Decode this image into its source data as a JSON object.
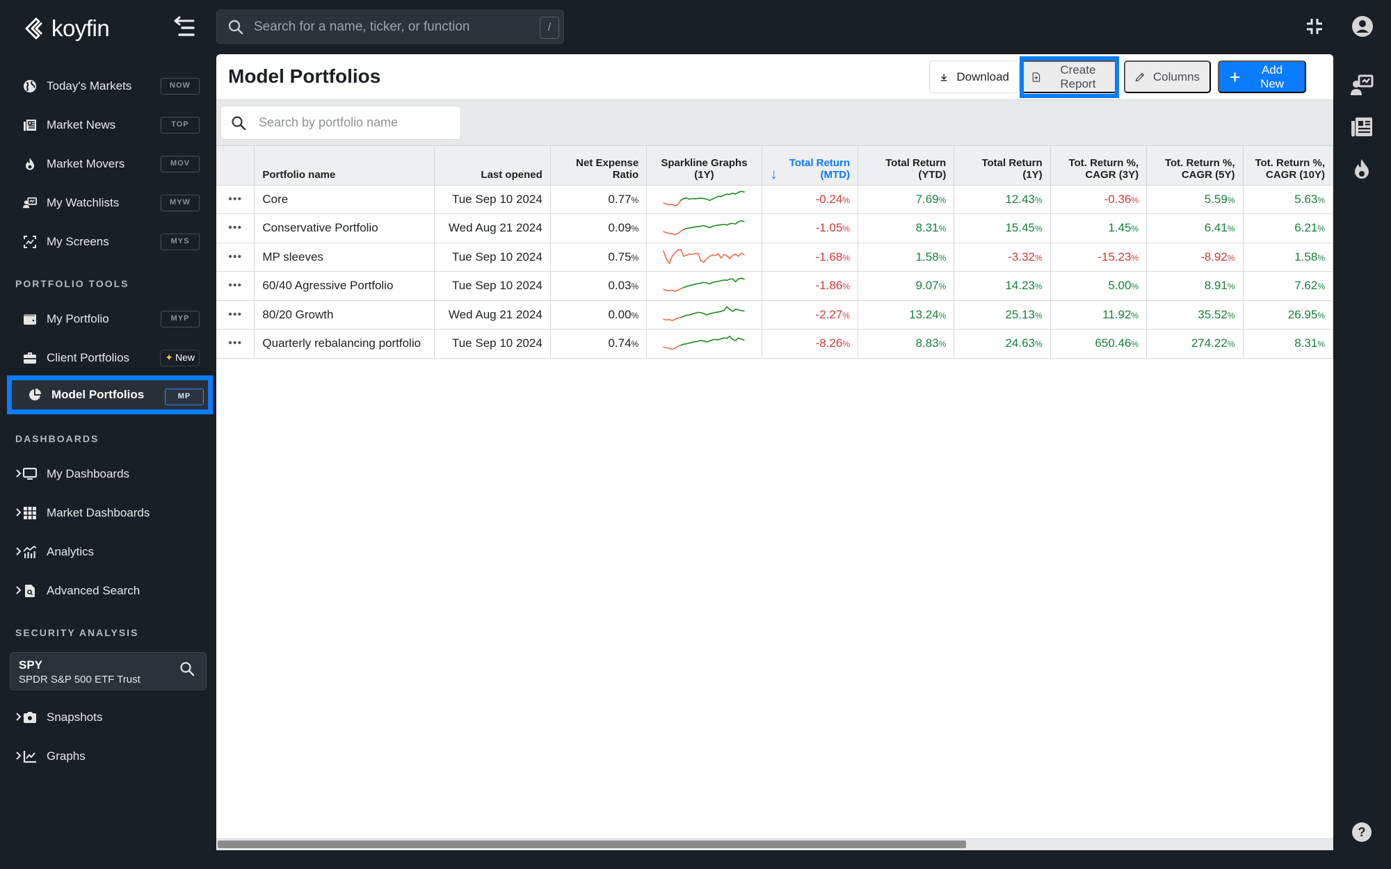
{
  "app": {
    "brand": "koyfin"
  },
  "topbar": {
    "search_placeholder": "Search for a name, ticker, or function",
    "search_shortcut": "/"
  },
  "sidebar": {
    "items_top": [
      {
        "label": "Today's Markets",
        "badge": "NOW",
        "icon": "globe-icon"
      },
      {
        "label": "Market News",
        "badge": "TOP",
        "icon": "newspaper-icon"
      },
      {
        "label": "Market Movers",
        "badge": "MOV",
        "icon": "flame-icon"
      },
      {
        "label": "My Watchlists",
        "badge": "MYW",
        "icon": "watchlist-icon"
      },
      {
        "label": "My Screens",
        "badge": "MYS",
        "icon": "screens-icon"
      }
    ],
    "portfolio_tools_title": "PORTFOLIO TOOLS",
    "portfolio_items": [
      {
        "label": "My Portfolio",
        "badge": "MYP",
        "icon": "wallet-icon"
      },
      {
        "label": "Client Portfolios",
        "badge": "New",
        "icon": "briefcase-icon"
      },
      {
        "label": "Model Portfolios",
        "badge": "MP",
        "icon": "pie-chart-icon",
        "active": true
      }
    ],
    "dashboards_title": "DASHBOARDS",
    "dashboard_items": [
      {
        "label": "My Dashboards",
        "icon": "monitor-icon"
      },
      {
        "label": "Market Dashboards",
        "icon": "grid-icon"
      },
      {
        "label": "Analytics",
        "icon": "analytics-icon"
      },
      {
        "label": "Advanced Search",
        "icon": "doc-search-icon"
      }
    ],
    "security_analysis_title": "SECURITY ANALYSIS",
    "security": {
      "ticker": "SPY",
      "name": "SPDR S&P 500 ETF Trust"
    },
    "security_items": [
      {
        "label": "Snapshots",
        "icon": "camera-icon"
      },
      {
        "label": "Graphs",
        "icon": "line-chart-icon"
      }
    ]
  },
  "main": {
    "title": "Model Portfolios",
    "toolbar": {
      "download_label": "Download",
      "create_report_label": "Create Report",
      "columns_label": "Columns",
      "add_new_label": "Add New"
    },
    "filter_placeholder": "Search by portfolio name",
    "table": {
      "columns": [
        {
          "key": "menu",
          "label": ""
        },
        {
          "key": "name",
          "label": "Portfolio name"
        },
        {
          "key": "last_opened",
          "label": "Last opened"
        },
        {
          "key": "expense",
          "label": "Net Expense Ratio"
        },
        {
          "key": "spark",
          "label": "Sparkline Graphs (1Y)"
        },
        {
          "key": "tr_mtd",
          "label": "Total Return (MTD)",
          "sorted": "desc"
        },
        {
          "key": "tr_ytd",
          "label": "Total Return (YTD)"
        },
        {
          "key": "tr_1y",
          "label": "Total Return (1Y)"
        },
        {
          "key": "cagr_3y",
          "label": "Tot. Return %, CAGR (3Y)"
        },
        {
          "key": "cagr_5y",
          "label": "Tot. Return %, CAGR (5Y)"
        },
        {
          "key": "cagr_10y",
          "label": "Tot. Return %, CAGR (10Y)"
        }
      ],
      "rows": [
        {
          "name": "Core",
          "last_opened": "Tue Sep 10 2024",
          "expense": "0.77",
          "tr_mtd": "-0.24",
          "tr_ytd": "7.69",
          "tr_1y": "12.43",
          "cagr_3y": "-0.36",
          "cagr_5y": "5.59",
          "cagr_10y": "5.63",
          "spark": [
            0.3,
            0.25,
            0.2,
            0.24,
            0.15,
            0.22,
            0.45,
            0.55,
            0.58,
            0.52,
            0.55,
            0.54,
            0.56,
            0.58,
            0.55,
            0.52,
            0.45,
            0.53,
            0.6,
            0.68,
            0.66,
            0.74,
            0.8,
            0.78,
            0.85,
            0.8,
            0.9,
            0.95,
            0.92
          ]
        },
        {
          "name": "Conservative Portfolio",
          "last_opened": "Wed Aug 21 2024",
          "expense": "0.09",
          "tr_mtd": "-1.05",
          "tr_ytd": "8.31",
          "tr_1y": "15.45",
          "cagr_3y": "1.45",
          "cagr_5y": "6.41",
          "cagr_10y": "6.21",
          "spark": [
            0.3,
            0.24,
            0.2,
            0.18,
            0.14,
            0.2,
            0.32,
            0.42,
            0.48,
            0.5,
            0.53,
            0.56,
            0.58,
            0.6,
            0.63,
            0.58,
            0.52,
            0.6,
            0.64,
            0.66,
            0.68,
            0.7,
            0.66,
            0.74,
            0.76,
            0.72,
            0.85,
            0.9,
            0.86
          ]
        },
        {
          "name": "MP sleeves",
          "last_opened": "Tue Sep 10 2024",
          "expense": "0.75",
          "tr_mtd": "-1.68",
          "tr_ytd": "1.58",
          "tr_1y": "-3.32",
          "cagr_3y": "-15.23",
          "cagr_5y": "-8.92",
          "cagr_10y": "1.58",
          "spark": [
            0.85,
            0.4,
            0.15,
            0.55,
            0.75,
            0.9,
            0.92,
            0.55,
            0.62,
            0.68,
            0.66,
            0.7,
            0.72,
            0.3,
            0.22,
            0.4,
            0.55,
            0.62,
            0.6,
            0.7,
            0.45,
            0.65,
            0.58,
            0.42,
            0.6,
            0.68,
            0.55,
            0.72,
            0.65
          ]
        },
        {
          "name": "60/40 Agressive Portfolio",
          "last_opened": "Tue Sep 10 2024",
          "expense": "0.03",
          "tr_mtd": "-1.86",
          "tr_ytd": "9.07",
          "tr_1y": "14.23",
          "cagr_3y": "5.00",
          "cagr_5y": "8.91",
          "cagr_10y": "7.62",
          "spark": [
            0.3,
            0.25,
            0.22,
            0.26,
            0.18,
            0.26,
            0.34,
            0.4,
            0.46,
            0.5,
            0.55,
            0.58,
            0.62,
            0.65,
            0.68,
            0.66,
            0.6,
            0.68,
            0.72,
            0.74,
            0.78,
            0.82,
            0.8,
            0.86,
            0.88,
            0.72,
            0.88,
            0.92,
            0.86
          ]
        },
        {
          "name": "80/20 Growth",
          "last_opened": "Wed Aug 21 2024",
          "expense": "0.00",
          "tr_mtd": "-2.27",
          "tr_ytd": "13.24",
          "tr_1y": "25.13",
          "cagr_3y": "11.92",
          "cagr_5y": "35.52",
          "cagr_10y": "26.95",
          "spark": [
            0.28,
            0.22,
            0.25,
            0.18,
            0.26,
            0.32,
            0.36,
            0.42,
            0.48,
            0.5,
            0.55,
            0.6,
            0.64,
            0.62,
            0.58,
            0.5,
            0.56,
            0.6,
            0.64,
            0.66,
            0.7,
            0.75,
            0.95,
            0.8,
            0.7,
            0.82,
            0.78,
            0.74,
            0.72
          ]
        },
        {
          "name": "Quarterly rebalancing portfolio",
          "last_opened": "Tue Sep 10 2024",
          "expense": "0.74",
          "tr_mtd": "-8.26",
          "tr_ytd": "8.83",
          "tr_1y": "24.63",
          "cagr_3y": "650.46",
          "cagr_5y": "274.22",
          "cagr_10y": "8.31",
          "spark": [
            0.3,
            0.26,
            0.22,
            0.18,
            0.24,
            0.34,
            0.4,
            0.46,
            0.48,
            0.52,
            0.56,
            0.6,
            0.62,
            0.66,
            0.64,
            0.58,
            0.64,
            0.7,
            0.72,
            0.7,
            0.76,
            0.8,
            0.78,
            0.9,
            0.72,
            0.66,
            0.8,
            0.74,
            0.68
          ]
        }
      ],
      "pct_suffix": "%"
    },
    "horizontal_scroll_fraction": 0.67
  },
  "colors": {
    "accent": "#0a7cff",
    "positive": "#17803d",
    "negative": "#d13a36",
    "spark_positive": "#1e8c1e",
    "spark_negative": "#ef6a4c"
  }
}
